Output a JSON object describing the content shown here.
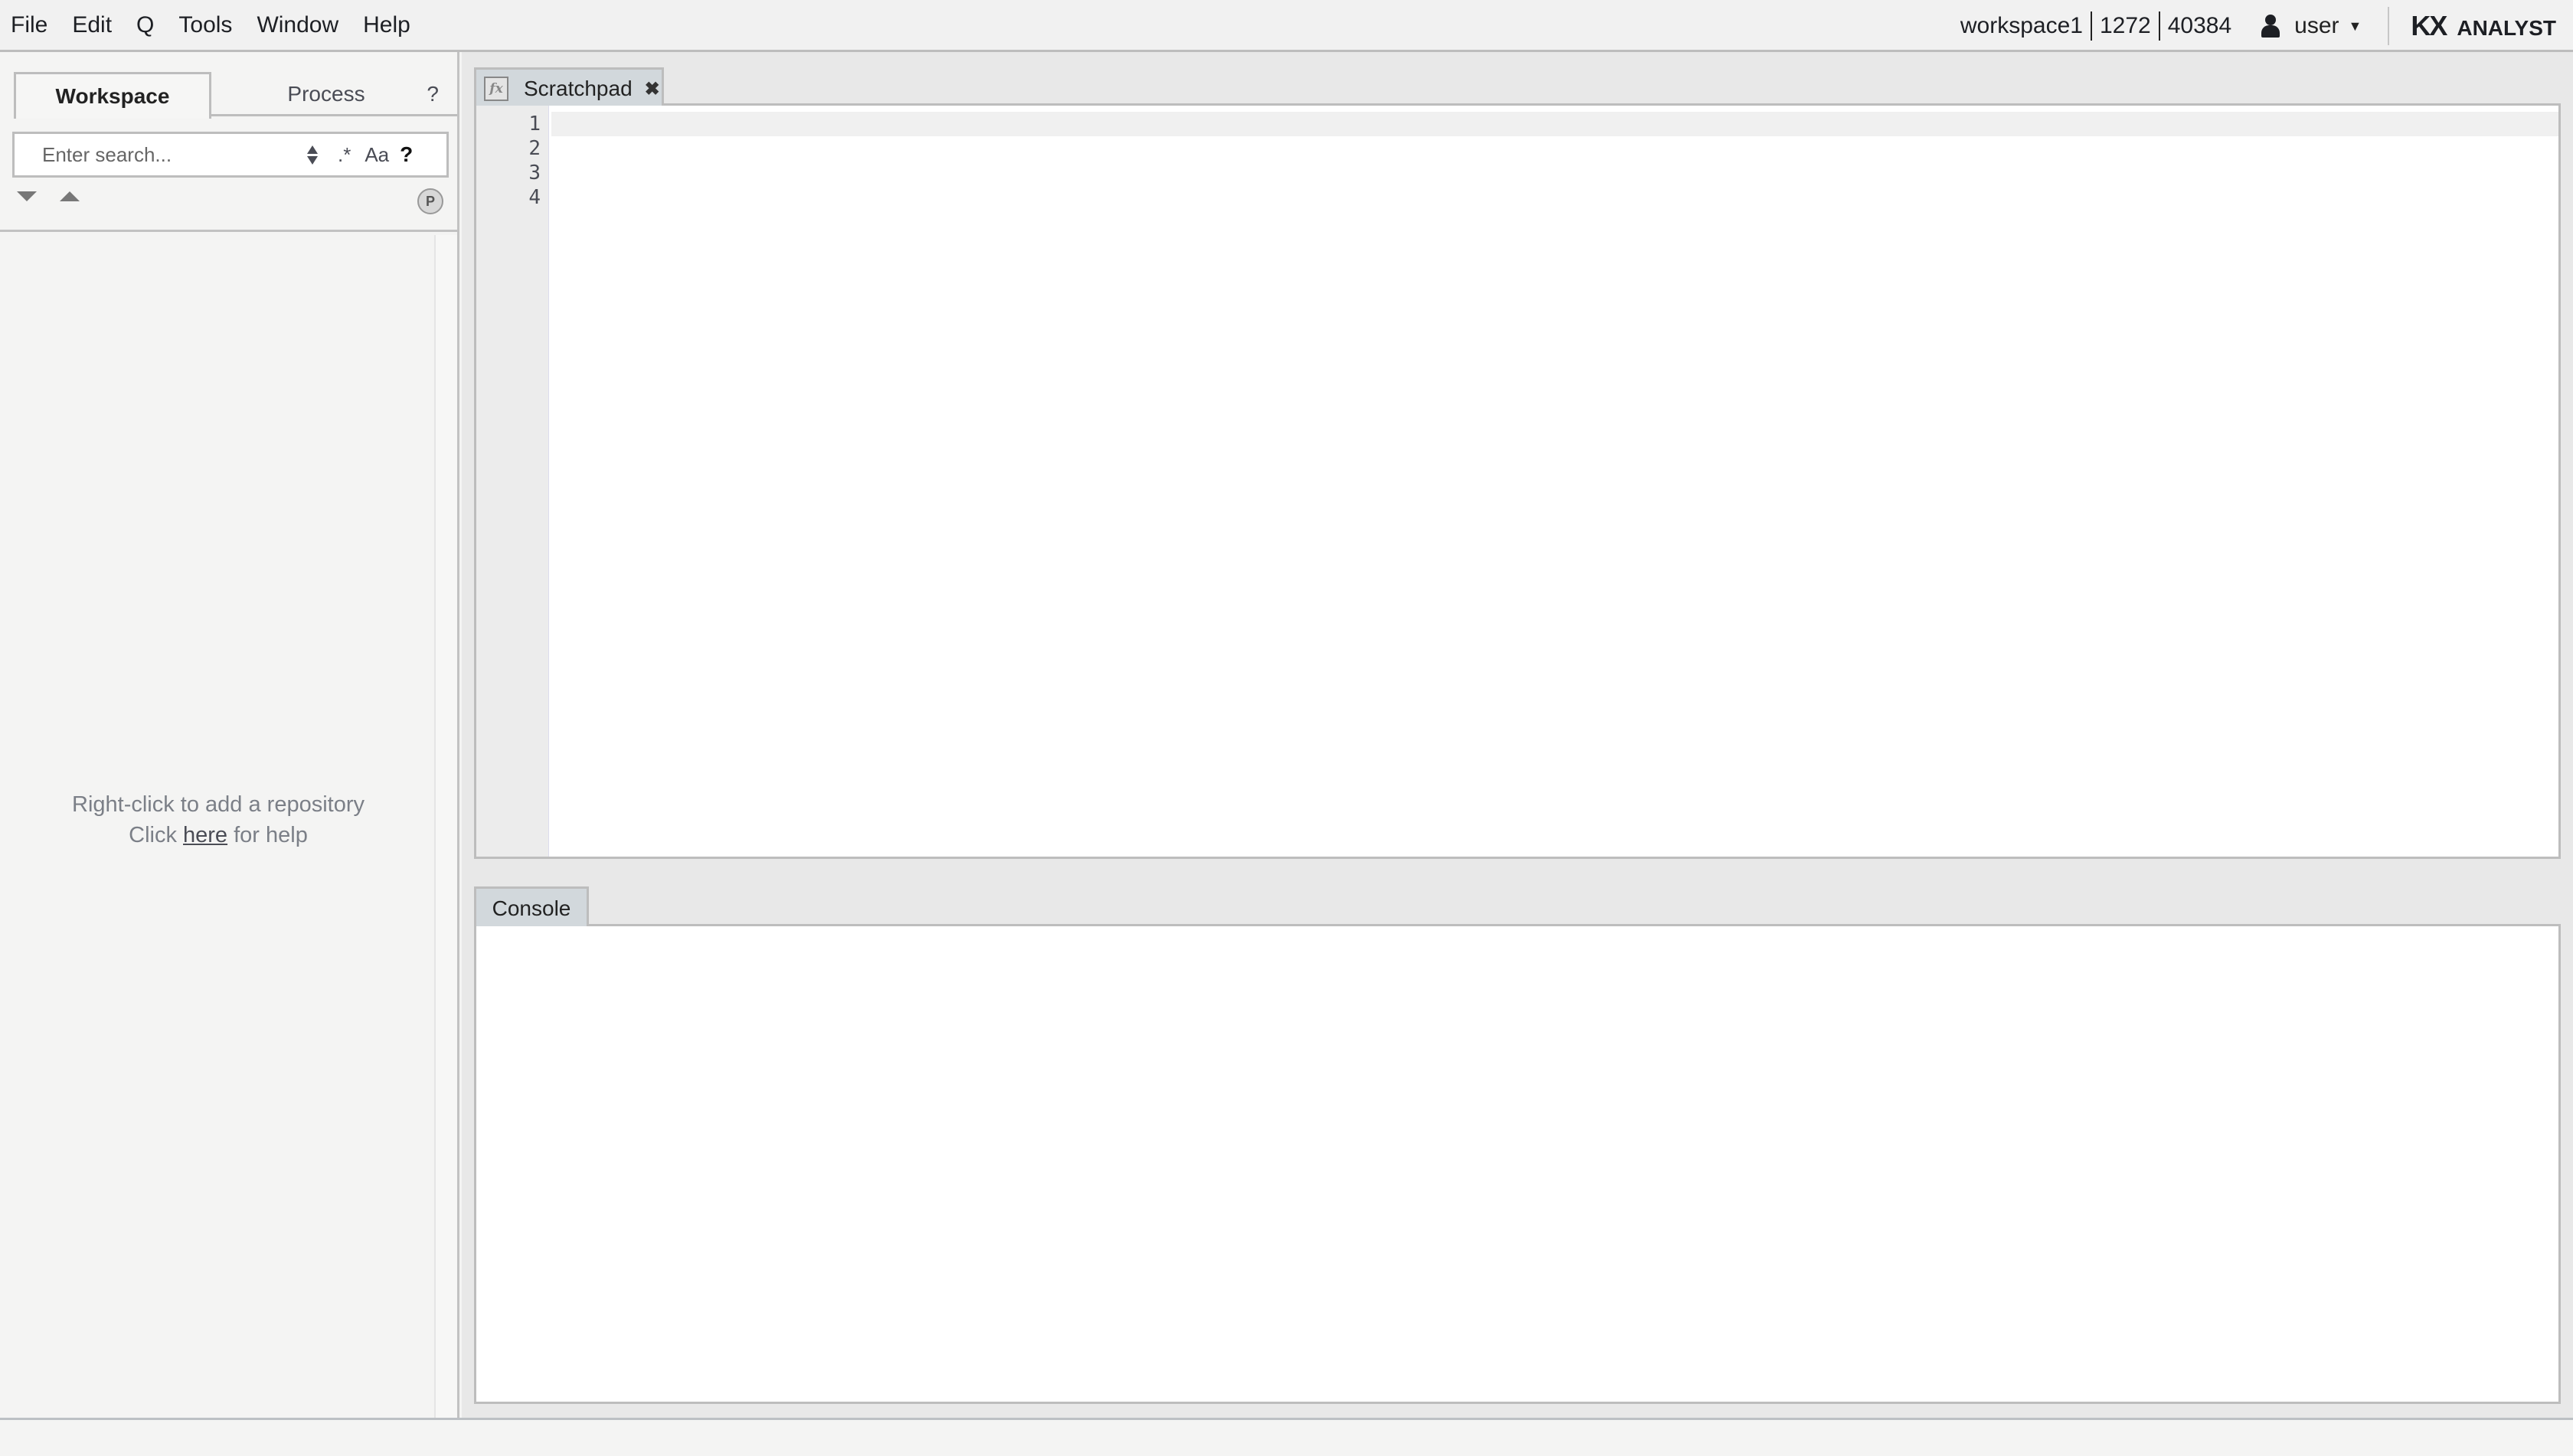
{
  "menu": {
    "items": [
      {
        "label": "File"
      },
      {
        "label": "Edit"
      },
      {
        "label": "Q"
      },
      {
        "label": "Tools"
      },
      {
        "label": "Window"
      },
      {
        "label": "Help"
      }
    ]
  },
  "header": {
    "workspace": "workspace1",
    "value1": "1272",
    "value2": "40384",
    "user": "user",
    "user_caret": "▼",
    "brand_logo": "KX",
    "brand_name": "ANALYST"
  },
  "left_panel": {
    "tabs": {
      "workspace": "Workspace",
      "process": "Process",
      "help": "?"
    },
    "search": {
      "placeholder": "Enter search...",
      "value": "",
      "regex_label": ".*",
      "case_label": "Aa",
      "help_label": "?"
    },
    "p_icon_label": "P",
    "empty_message": {
      "line1": "Right-click to add a repository",
      "line2_prefix": "Click ",
      "line2_link": "here",
      "line2_suffix": " for help"
    }
  },
  "editor": {
    "tab": {
      "icon": "fx",
      "label": "Scratchpad",
      "close": "✖"
    },
    "line_numbers": [
      "1",
      "2",
      "3",
      "4"
    ],
    "content": ""
  },
  "console": {
    "tab_label": "Console",
    "content": ""
  }
}
